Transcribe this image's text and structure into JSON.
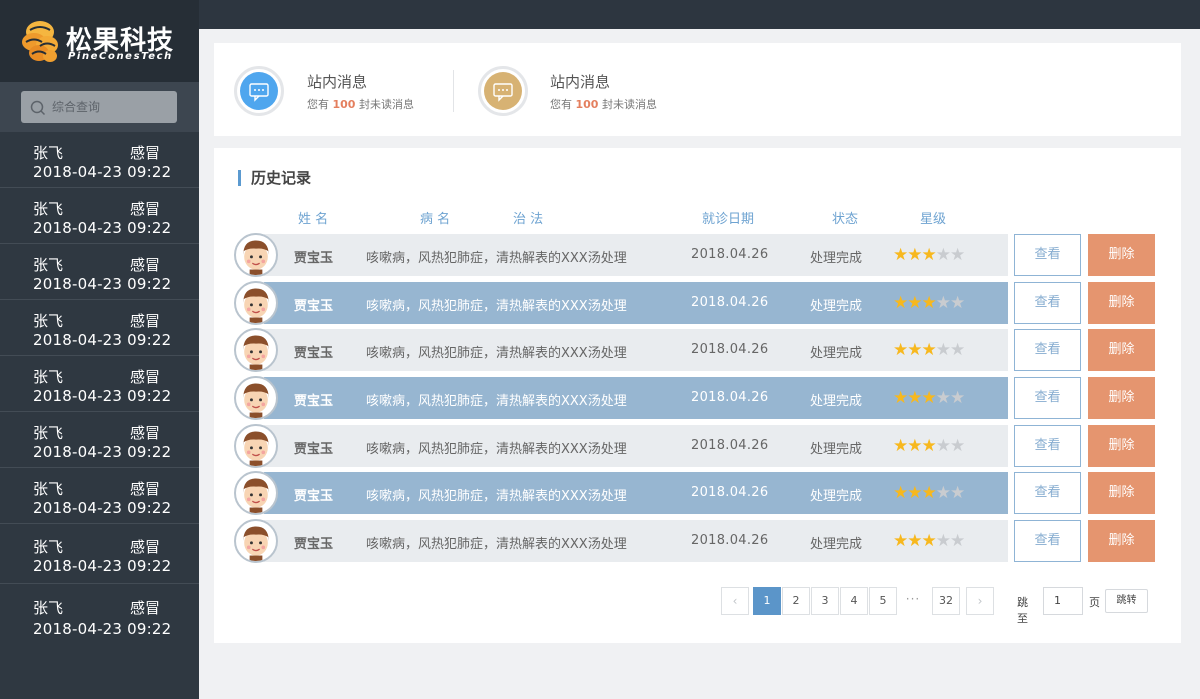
{
  "brand": {
    "name_cn": "松果科技",
    "name_en": "PineConesTech",
    "logo_color": "#f2a93b"
  },
  "sidebar": {
    "search_placeholder": "综合查询",
    "items": [
      {
        "name": "张飞",
        "diagnosis": "感冒",
        "datetime": "2018-04-23  09:22"
      },
      {
        "name": "张飞",
        "diagnosis": "感冒",
        "datetime": "2018-04-23  09:22"
      },
      {
        "name": "张飞",
        "diagnosis": "感冒",
        "datetime": "2018-04-23  09:22"
      },
      {
        "name": "张飞",
        "diagnosis": "感冒",
        "datetime": "2018-04-23  09:22"
      },
      {
        "name": "张飞",
        "diagnosis": "感冒",
        "datetime": "2018-04-23  09:22"
      },
      {
        "name": "张飞",
        "diagnosis": "感冒",
        "datetime": "2018-04-23  09:22"
      },
      {
        "name": "张飞",
        "diagnosis": "感冒",
        "datetime": "2018-04-23  09:22"
      },
      {
        "name": "张飞",
        "diagnosis": "感冒",
        "datetime": "2018-04-23  09:22"
      },
      {
        "name": "张飞",
        "diagnosis": "感冒",
        "datetime": "2018-04-23  09:22"
      }
    ]
  },
  "messages": [
    {
      "title": "站内消息",
      "prefix": "您有",
      "count": "100",
      "suffix": "封未读消息",
      "icon": "chat-bubble-icon",
      "color": "#4fa6ee"
    },
    {
      "title": "站内消息",
      "prefix": "您有",
      "count": "100",
      "suffix": "封未读消息",
      "icon": "chat-bubble-icon",
      "color": "#d7b273"
    }
  ],
  "history": {
    "title": "历史记录",
    "columns": {
      "name": "姓 名",
      "disease": "病 名",
      "treatment": "治 法",
      "date": "就诊日期",
      "status": "状态",
      "rating": "星级"
    },
    "view_label": "查看",
    "delete_label": "删除",
    "rows": [
      {
        "name": "贾宝玉",
        "desc": "咳嗽病，风热犯肺症，清热解表的XXX汤处理",
        "date": "2018.04.26",
        "status": "处理完成",
        "stars": 3,
        "max_stars": 5
      },
      {
        "name": "贾宝玉",
        "desc": "咳嗽病，风热犯肺症，清热解表的XXX汤处理",
        "date": "2018.04.26",
        "status": "处理完成",
        "stars": 3,
        "max_stars": 5
      },
      {
        "name": "贾宝玉",
        "desc": "咳嗽病，风热犯肺症，清热解表的XXX汤处理",
        "date": "2018.04.26",
        "status": "处理完成",
        "stars": 3,
        "max_stars": 5
      },
      {
        "name": "贾宝玉",
        "desc": "咳嗽病，风热犯肺症，清热解表的XXX汤处理",
        "date": "2018.04.26",
        "status": "处理完成",
        "stars": 3,
        "max_stars": 5
      },
      {
        "name": "贾宝玉",
        "desc": "咳嗽病，风热犯肺症，清热解表的XXX汤处理",
        "date": "2018.04.26",
        "status": "处理完成",
        "stars": 3,
        "max_stars": 5
      },
      {
        "name": "贾宝玉",
        "desc": "咳嗽病，风热犯肺症，清热解表的XXX汤处理",
        "date": "2018.04.26",
        "status": "处理完成",
        "stars": 3,
        "max_stars": 5
      },
      {
        "name": "贾宝玉",
        "desc": "咳嗽病，风热犯肺症，清热解表的XXX汤处理",
        "date": "2018.04.26",
        "status": "处理完成",
        "stars": 3,
        "max_stars": 5
      }
    ]
  },
  "pagination": {
    "prev": "‹",
    "next": "›",
    "pages": [
      "1",
      "2",
      "3",
      "4",
      "5"
    ],
    "ellipsis": "···",
    "last": "32",
    "current": "1",
    "jump_label": "跳至",
    "jump_value": "1",
    "page_unit": "页",
    "jump_button": "跳转"
  },
  "colors": {
    "accent": "#5b95c9",
    "delete": "#e5956f",
    "highlight_row": "#97b6d1",
    "sidebar_bg": "#2f3841"
  }
}
